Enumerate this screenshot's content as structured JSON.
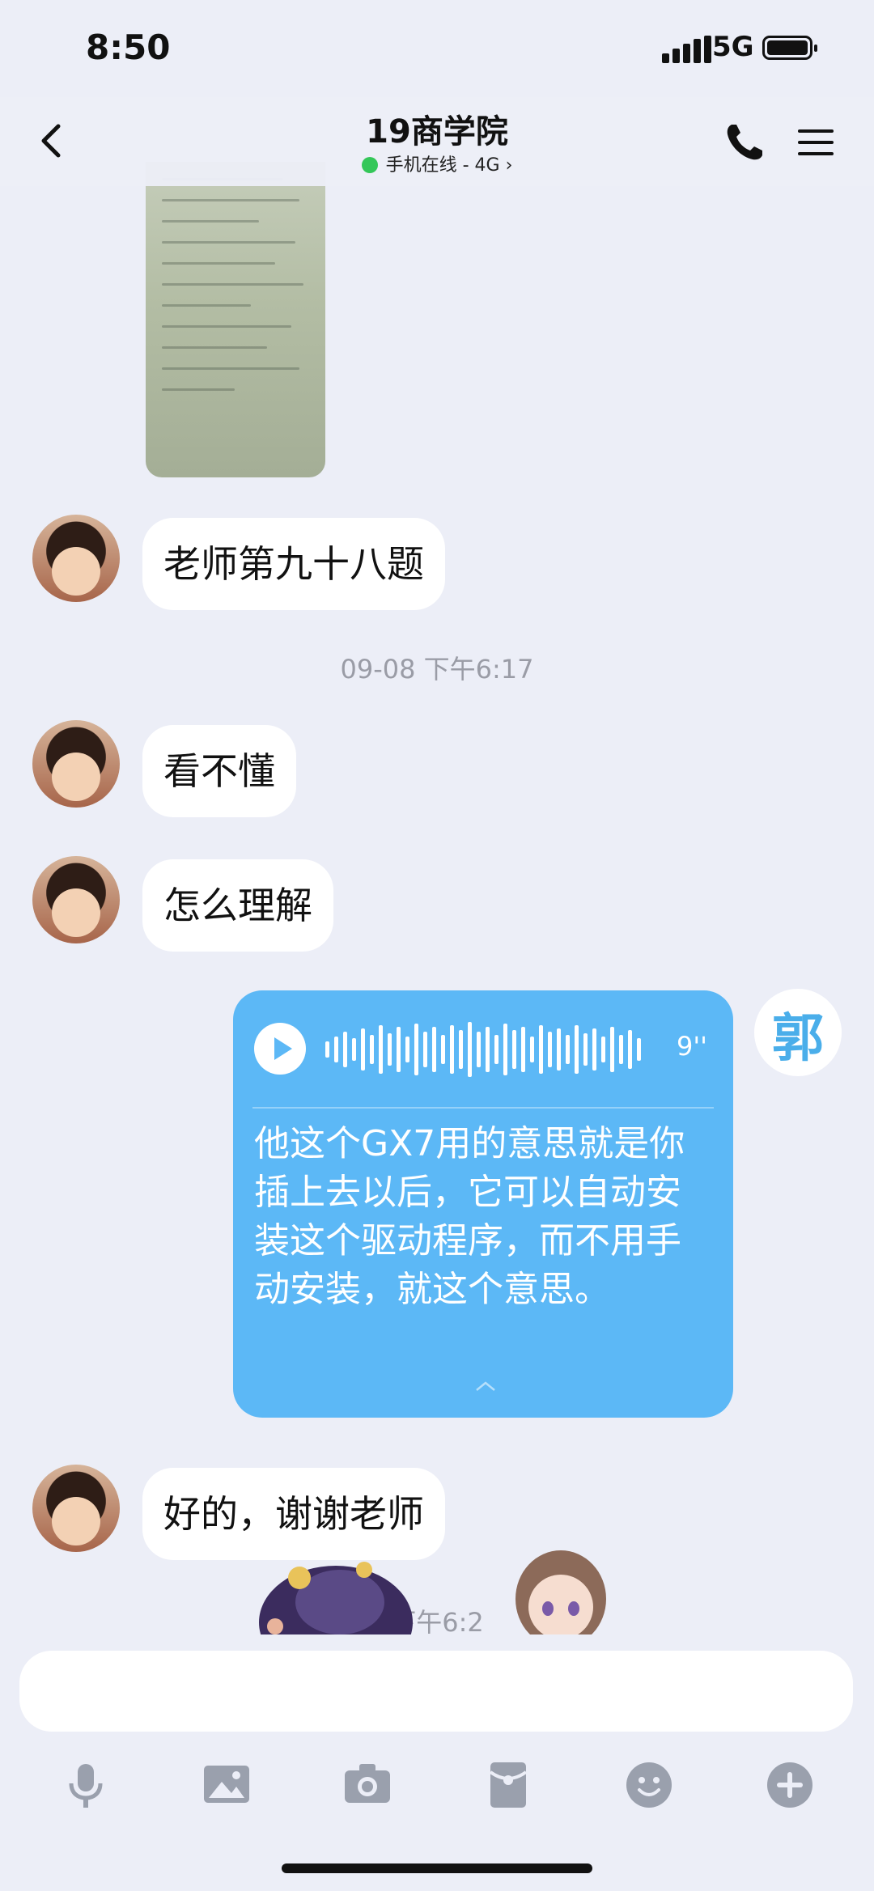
{
  "status_bar": {
    "time": "8:50",
    "network": "5G"
  },
  "header": {
    "title": "19商学院",
    "presence": "手机在线 - 4G",
    "presence_color": "#34c759"
  },
  "messages": {
    "m1": "老师第九十八题",
    "timestamp1": "09-08 下午6:17",
    "m2": "看不懂",
    "m3": "怎么理解",
    "voice": {
      "duration": "9''",
      "transcript": "他这个GX7用的意思就是你插上去以后，它可以自动安装这个驱动程序，而不用手动安装，就这个意思。"
    },
    "my_avatar_char": "郭",
    "m4": "好的，谢谢老师",
    "timestamp2_partial": "下午6:2"
  },
  "toolbar": {
    "items": [
      "microphone-icon",
      "image-icon",
      "camera-icon",
      "red-packet-icon",
      "emoji-icon",
      "plus-icon"
    ]
  },
  "colors": {
    "background": "#eceef7",
    "voice_bubble": "#5cb8f6",
    "accent": "#4aaeea"
  }
}
